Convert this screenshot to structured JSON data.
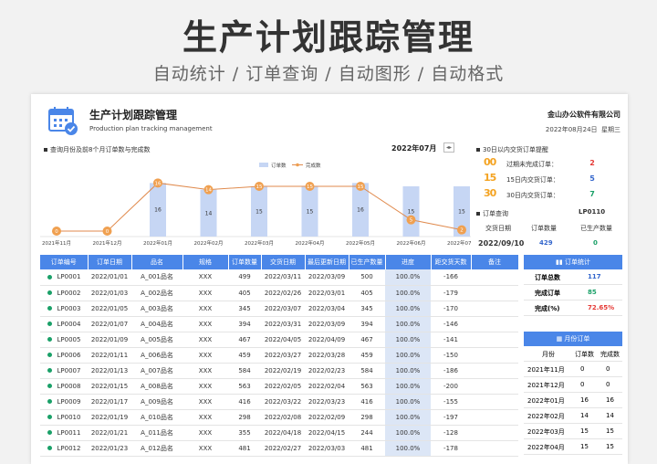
{
  "banner": {
    "title": "生产计划跟踪管理",
    "subtitle": "自动统计 / 订单查询 / 自动图形 / 自动格式"
  },
  "header": {
    "title": "生产计划跟踪管理",
    "subtitle": "Production plan tracking management",
    "company": "金山办公软件有限公司",
    "date": "2022年08月24日",
    "weekday": "星期三"
  },
  "chart_section": {
    "label": "查询月份及前8个月订单数与完成数",
    "month": "2022年07月"
  },
  "chart_data": {
    "type": "bar",
    "categories": [
      "2021年11月",
      "2021年12月",
      "2022年01月",
      "2022年02月",
      "2022年03月",
      "2022年04月",
      "2022年05月",
      "2022年06月",
      "2022年07月"
    ],
    "series": [
      {
        "name": "订单数",
        "values": [
          0,
          0,
          16,
          14,
          15,
          15,
          16,
          15,
          15
        ]
      },
      {
        "name": "完成数",
        "values": [
          0,
          0,
          16,
          14,
          15,
          15,
          15,
          5,
          2
        ]
      }
    ],
    "bar_labels": [
      "",
      "",
      "16",
      "14",
      "15",
      "15",
      "16",
      "15",
      "15"
    ],
    "line_labels": [
      "0",
      "0",
      "16",
      "14",
      "15",
      "15",
      "15",
      "5",
      "2"
    ],
    "legend": "top",
    "colors": {
      "bar": "#c6d6f4",
      "line": "#e08a4d",
      "marker": "#f0a050"
    }
  },
  "due_section": {
    "label": "30日以内交货订单提醒",
    "rows": [
      {
        "digits": "00",
        "label": "过期未完成订单：",
        "value": "2",
        "color": "#e53935"
      },
      {
        "digits": "15",
        "label": "15日内交货订单：",
        "value": "5",
        "color": "#3366cc"
      },
      {
        "digits": "30",
        "label": "30日内交货订单：",
        "value": "7",
        "color": "#1aa068"
      }
    ]
  },
  "query": {
    "label": "订单查询",
    "order_id": "LP0110",
    "col_date": "交货日期",
    "col_qty": "订单数量",
    "col_done": "已生产数量",
    "date": "2022/09/10",
    "qty": "429",
    "done": "0"
  },
  "table": {
    "headers": [
      "订单编号",
      "订单日期",
      "品名",
      "规格",
      "订单数量",
      "交货日期",
      "最后更新日期",
      "已生产数量",
      "进度",
      "距交货天数",
      "备注"
    ],
    "rows": [
      [
        "LP0001",
        "2022/01/01",
        "A_001品名",
        "XXX",
        "499",
        "2022/03/11",
        "2022/03/09",
        "500",
        "100.0%",
        "-166",
        ""
      ],
      [
        "LP0002",
        "2022/01/03",
        "A_002品名",
        "XXX",
        "405",
        "2022/02/26",
        "2022/03/01",
        "405",
        "100.0%",
        "-179",
        ""
      ],
      [
        "LP0003",
        "2022/01/05",
        "A_003品名",
        "XXX",
        "345",
        "2022/03/07",
        "2022/03/04",
        "345",
        "100.0%",
        "-170",
        ""
      ],
      [
        "LP0004",
        "2022/01/07",
        "A_004品名",
        "XXX",
        "394",
        "2022/03/31",
        "2022/03/09",
        "394",
        "100.0%",
        "-146",
        ""
      ],
      [
        "LP0005",
        "2022/01/09",
        "A_005品名",
        "XXX",
        "467",
        "2022/04/05",
        "2022/04/09",
        "467",
        "100.0%",
        "-141",
        ""
      ],
      [
        "LP0006",
        "2022/01/11",
        "A_006品名",
        "XXX",
        "459",
        "2022/03/27",
        "2022/03/28",
        "459",
        "100.0%",
        "-150",
        ""
      ],
      [
        "LP0007",
        "2022/01/13",
        "A_007品名",
        "XXX",
        "584",
        "2022/02/19",
        "2022/02/23",
        "584",
        "100.0%",
        "-186",
        ""
      ],
      [
        "LP0008",
        "2022/01/15",
        "A_008品名",
        "XXX",
        "563",
        "2022/02/05",
        "2022/02/04",
        "563",
        "100.0%",
        "-200",
        ""
      ],
      [
        "LP0009",
        "2022/01/17",
        "A_009品名",
        "XXX",
        "416",
        "2022/03/22",
        "2022/03/23",
        "416",
        "100.0%",
        "-155",
        ""
      ],
      [
        "LP0010",
        "2022/01/19",
        "A_010品名",
        "XXX",
        "298",
        "2022/02/08",
        "2022/02/09",
        "298",
        "100.0%",
        "-197",
        ""
      ],
      [
        "LP0011",
        "2022/01/21",
        "A_011品名",
        "XXX",
        "355",
        "2022/04/18",
        "2022/04/15",
        "244",
        "100.0%",
        "-128",
        ""
      ],
      [
        "LP0012",
        "2022/01/23",
        "A_012品名",
        "XXX",
        "481",
        "2022/02/27",
        "2022/03/03",
        "481",
        "100.0%",
        "-178",
        ""
      ]
    ]
  },
  "order_stats": {
    "title": "订单统计",
    "rows": [
      {
        "label": "订单总数",
        "value": "117",
        "color": "#3366cc"
      },
      {
        "label": "完成订单",
        "value": "85",
        "color": "#1aa068"
      },
      {
        "label": "完成(%)",
        "value": "72.65%",
        "color": "#e53935"
      }
    ]
  },
  "monthly": {
    "title": "月份订单",
    "headers": [
      "月份",
      "订单数",
      "完成数"
    ],
    "rows": [
      [
        "2021年11月",
        "0",
        "0"
      ],
      [
        "2021年12月",
        "0",
        "0"
      ],
      [
        "2022年01月",
        "16",
        "16"
      ],
      [
        "2022年02月",
        "14",
        "14"
      ],
      [
        "2022年03月",
        "15",
        "15"
      ],
      [
        "2022年04月",
        "15",
        "15"
      ]
    ]
  }
}
